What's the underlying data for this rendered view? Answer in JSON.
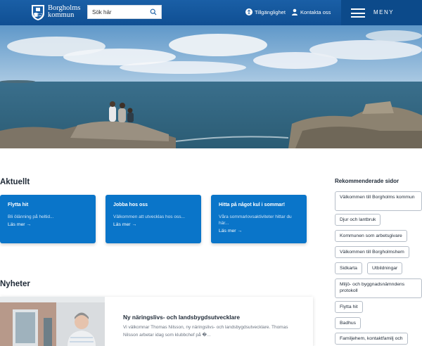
{
  "header": {
    "logo_line1": "Borgholms",
    "logo_line2": "kommun",
    "search_placeholder": "Sök här",
    "accessibility_label": "Tillgänglighet",
    "contact_label": "Kontakta oss",
    "menu_label": "MENY"
  },
  "aktuellt": {
    "title": "Aktuellt",
    "cards": [
      {
        "title": "Flytta hit",
        "desc": "Bli ölänning på heltid...",
        "link": "Läs mer →"
      },
      {
        "title": "Jobba hos oss",
        "desc": "Välkommen att utvecklas hos oss...",
        "link": "Läs mer →"
      },
      {
        "title": "Hitta på något kul i sommar!",
        "desc": "Våra sommarlovsaktiviteter hittar du här...",
        "link": "Läs mer →"
      }
    ]
  },
  "recommended": {
    "title": "Rekommenderade sidor",
    "items": [
      "Välkommen till Borgholms kommun",
      "Djur och lantbruk",
      "Kommunen som arbetsgivare",
      "Välkommen till Borgholmshem",
      "Sidkarta",
      "Utbildningar",
      "Miljö- och byggnadsnämndens protokoll",
      "Flytta hit",
      "Badhus",
      "Familjehem, kontaktfamilj och"
    ]
  },
  "nyheter": {
    "title": "Nyheter",
    "news_title": "Ny näringslivs- och landsbygdsutvecklare",
    "news_text": "Vi välkomnar Thomas Nilsson, ny näringslivs- och landsbygdsutvecklare. Thomas Nilsson arbetar idag som klubbchef på �..."
  },
  "colors": {
    "header_blue": "#1a5fa6",
    "menu_blue": "#0c4a8a",
    "card_blue": "#0a75c9"
  }
}
